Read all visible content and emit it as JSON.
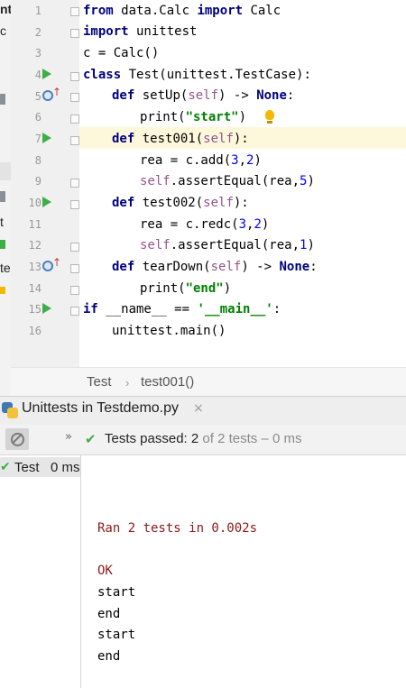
{
  "left_strip_fragments": [
    "nti",
    "c",
    "t",
    "te"
  ],
  "gutter": {
    "line_numbers": [
      "1",
      "2",
      "3",
      "4",
      "5",
      "6",
      "7",
      "8",
      "9",
      "10",
      "11",
      "12",
      "13",
      "14",
      "15",
      "16"
    ]
  },
  "code": {
    "l1": {
      "kw1": "from",
      "mid": " data.Calc ",
      "kw2": "import",
      "end": " Calc"
    },
    "l2": {
      "kw": "import",
      "end": " unittest"
    },
    "l3": {
      "text": "c = Calc()"
    },
    "l4": {
      "kw": "class",
      "end": " Test(unittest.TestCase):"
    },
    "l5": {
      "kw": "def",
      "name": " setUp(",
      "self": "self",
      "end": ") -> ",
      "none": "None",
      ":": ":"
    },
    "l6": {
      "pre": "print(",
      "str": "\"start\"",
      "post": ")"
    },
    "l7": {
      "kw": "def",
      "name": " test001(",
      "self": "self",
      "end": "):"
    },
    "l8": {
      "pre": "rea = c.add(",
      "n1": "3",
      "comma": ",",
      "n2": "2",
      "post": ")"
    },
    "l9": {
      "self": "self",
      "mid": ".assertEqual(rea,",
      "n": "5",
      "post": ")"
    },
    "l10": {
      "kw": "def",
      "name": " test002(",
      "self": "self",
      "end": "):"
    },
    "l11": {
      "pre": "rea = c.redc(",
      "n1": "3",
      "comma": ",",
      "n2": "2",
      "post": ")"
    },
    "l12": {
      "self": "self",
      "mid": ".assertEqual(rea,",
      "n": "1",
      "post": ")"
    },
    "l13": {
      "kw": "def",
      "name": " tearDown(",
      "self": "self",
      "end": ") -> ",
      "none": "None",
      ":": ":"
    },
    "l14": {
      "pre": "print(",
      "str": "\"end\"",
      "post": ")"
    },
    "l15": {
      "kw": "if",
      "mid": " __name__ == ",
      "str": "'__main__'",
      "post": ":"
    },
    "l16": {
      "text": "unittest.main()"
    }
  },
  "breadcrumb": {
    "items": [
      "Test",
      "test001()"
    ],
    "separator": "›"
  },
  "tool_window": {
    "title": "Unittests in Testdemo.py",
    "close_glyph": "×"
  },
  "toolbar": {
    "chevron": "»",
    "check_glyph": "✔",
    "status_main": "Tests passed: 2",
    "status_muted": " of 2 tests – 0 ms"
  },
  "tree": {
    "check_glyph": "✔",
    "label": "Test",
    "time": "0 ms"
  },
  "console": {
    "ran": "Ran 2 tests in 0.002s",
    "ok": "OK",
    "lines": [
      "start",
      "end",
      "start",
      "end"
    ]
  },
  "colors": {
    "keyword": "#000080",
    "self": "#94558d",
    "string": "#008000",
    "number": "#0000ff",
    "pass": "#3fae49",
    "error_text": "#8b1a1a"
  }
}
